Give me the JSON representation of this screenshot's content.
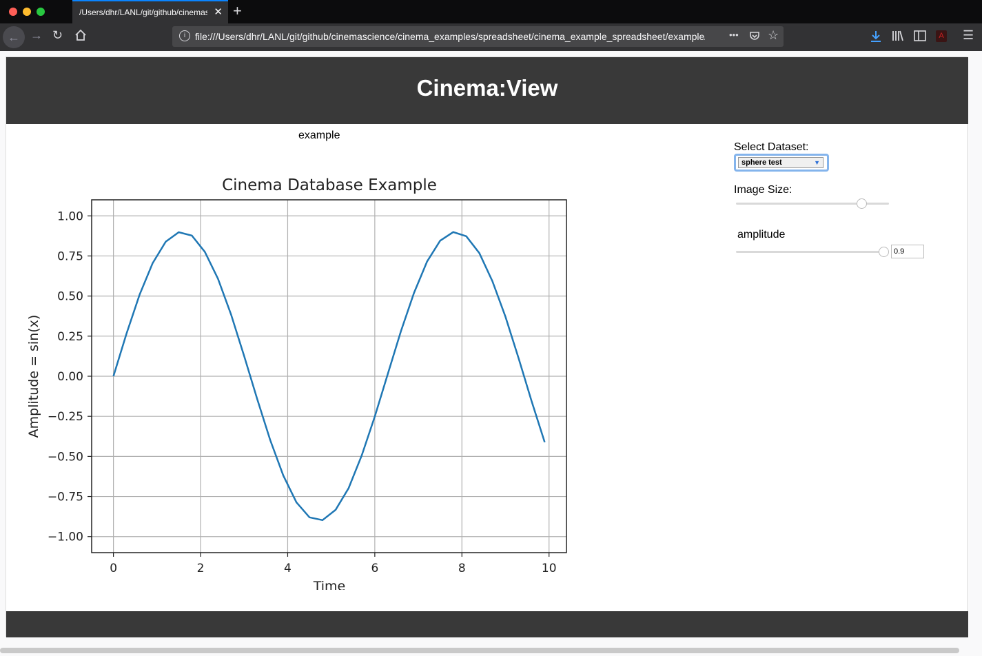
{
  "browser": {
    "tab_title": "/Users/dhr/LANL/git/github/cinemascience/cinema_examples/spreadsheet/cinema_example_spreadsheet/example",
    "tab_close": "✕",
    "new_tab": "+",
    "url": "file:///Users/dhr/LANL/git/github/cinemascience/cinema_examples/spreadsheet/cinema_example_spreadsheet/example/index.html",
    "page_actions": "•••"
  },
  "app": {
    "title": "Cinema:View",
    "image_label": "example"
  },
  "controls": {
    "dataset_label": "Select Dataset:",
    "dataset_value": "sphere test",
    "image_size_label": "Image Size:",
    "image_size_level": 0.82,
    "amplitude_label": "amplitude",
    "amplitude_level": 1.0,
    "amplitude_value": "0.9"
  },
  "icons": [
    "back-icon",
    "forward-icon",
    "reload-icon",
    "home-icon",
    "info-icon",
    "pocket-icon",
    "bookmark-star-icon",
    "download-icon",
    "library-icon",
    "sidebar-icon",
    "pdf-icon",
    "menu-icon"
  ],
  "colors": {
    "header": "#393939",
    "line": "#1f77b4",
    "focus": "#84b4ec"
  },
  "chart_data": {
    "type": "line",
    "title": "Cinema Database Example",
    "xlabel": "Time",
    "ylabel": "Amplitude = sin(x)",
    "xlim": [
      -0.5,
      10.4
    ],
    "ylim": [
      -1.1,
      1.1
    ],
    "xticks": [
      0,
      2,
      4,
      6,
      8,
      10
    ],
    "xtick_labels": [
      "0",
      "2",
      "4",
      "6",
      "8",
      "10"
    ],
    "yticks": [
      1.0,
      0.75,
      0.5,
      0.25,
      0.0,
      -0.25,
      -0.5,
      -0.75,
      -1.0
    ],
    "ytick_labels": [
      "1.00",
      "0.75",
      "0.50",
      "0.25",
      "0.00",
      "−0.25",
      "−0.50",
      "−0.75",
      "−1.00"
    ],
    "grid": true,
    "series": [
      {
        "x": [
          0,
          0.3,
          0.6,
          0.9,
          1.2,
          1.5,
          1.8,
          2.1,
          2.4,
          2.7,
          3.0,
          3.3,
          3.6,
          3.9,
          4.2,
          4.5,
          4.8,
          5.1,
          5.4,
          5.7,
          6.0,
          6.3,
          6.6,
          6.9,
          7.2,
          7.5,
          7.8,
          8.1,
          8.4,
          8.7,
          9.0,
          9.3,
          9.6,
          9.9
        ],
        "y": [
          0.0,
          0.266,
          0.508,
          0.705,
          0.839,
          0.898,
          0.877,
          0.775,
          0.608,
          0.385,
          0.127,
          -0.142,
          -0.399,
          -0.619,
          -0.786,
          -0.88,
          -0.897,
          -0.833,
          -0.698,
          -0.494,
          -0.251,
          0.015,
          0.281,
          0.52,
          0.715,
          0.845,
          0.899,
          0.873,
          0.768,
          0.593,
          0.371,
          0.113,
          -0.155,
          -0.411
        ]
      }
    ]
  }
}
